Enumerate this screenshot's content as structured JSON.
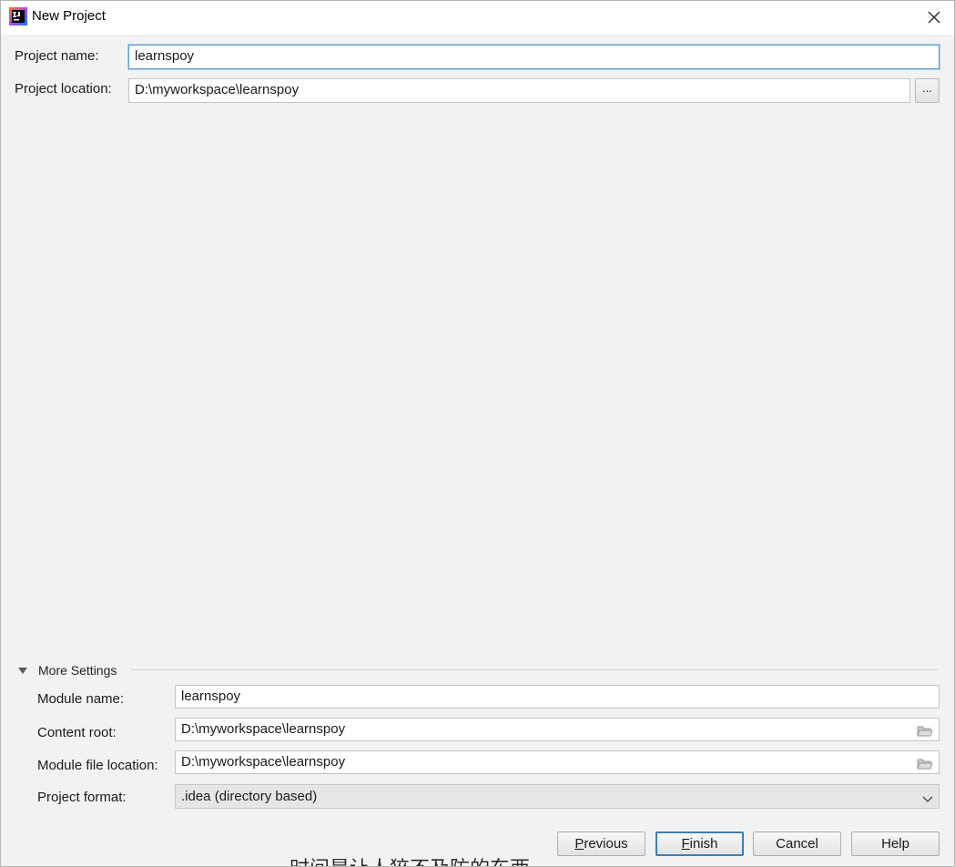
{
  "window": {
    "title": "New Project",
    "app_icon": "intellij-idea-icon",
    "close_icon": "close-icon"
  },
  "project": {
    "name_label": "Project name:",
    "name_value": "learnspoy",
    "location_label": "Project location:",
    "location_value": "D:\\myworkspace\\learnspoy",
    "browse_label": "..."
  },
  "more_settings": {
    "header": "More Settings",
    "module_name_label": "Module name:",
    "module_name_value": "learnspoy",
    "content_root_label": "Content root:",
    "content_root_value": "D:\\myworkspace\\learnspoy",
    "module_file_label": "Module file location:",
    "module_file_value": "D:\\myworkspace\\learnspoy",
    "format_label": "Project format:",
    "format_value": ".idea (directory based)"
  },
  "buttons": {
    "previous_mnemonic": "P",
    "previous_rest": "revious",
    "finish_mnemonic": "F",
    "finish_rest": "inish",
    "cancel": "Cancel",
    "help": "Help"
  },
  "overlay": {
    "subtitle": "时间是让人猝不及防的东西"
  },
  "colors": {
    "background": "#f2f2f2",
    "focus_border": "#5f9ecf",
    "default_button_border": "#3c7fb1"
  }
}
